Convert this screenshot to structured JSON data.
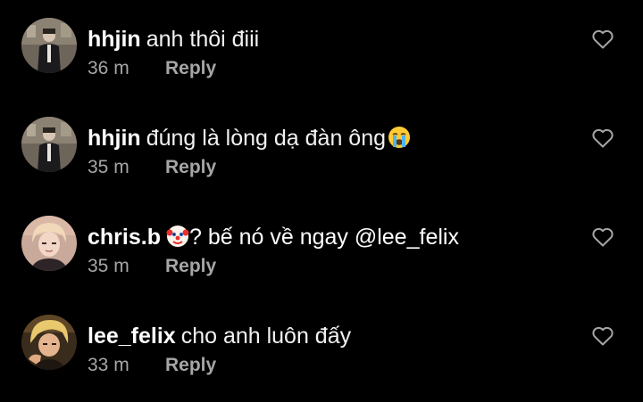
{
  "comments": [
    {
      "username": "hhjin",
      "text": "anh thôi điii",
      "emoji": "",
      "text_after_emoji": "",
      "time": "36 m",
      "reply_label": "Reply",
      "avatar": "avatar-hhjin"
    },
    {
      "username": "hhjin",
      "text": "đúng là lòng dạ đàn ông",
      "emoji": "loudly-crying-face-emoji",
      "text_after_emoji": "",
      "time": "35 m",
      "reply_label": "Reply",
      "avatar": "avatar-hhjin"
    },
    {
      "username": "chris.b",
      "text": "",
      "emoji": "clown-face-emoji",
      "text_after_emoji": "? bế nó về ngay @lee_felix",
      "time": "35 m",
      "reply_label": "Reply",
      "avatar": "avatar-chris"
    },
    {
      "username": "lee_felix",
      "text": "cho anh luôn đấy",
      "emoji": "",
      "text_after_emoji": "",
      "time": "33 m",
      "reply_label": "Reply",
      "avatar": "avatar-felix"
    }
  ],
  "colors": {
    "background": "#000000",
    "primary_text": "#ffffff",
    "secondary_text": "#a6a6a6"
  },
  "icons": {
    "like": "heart-outline-icon"
  }
}
